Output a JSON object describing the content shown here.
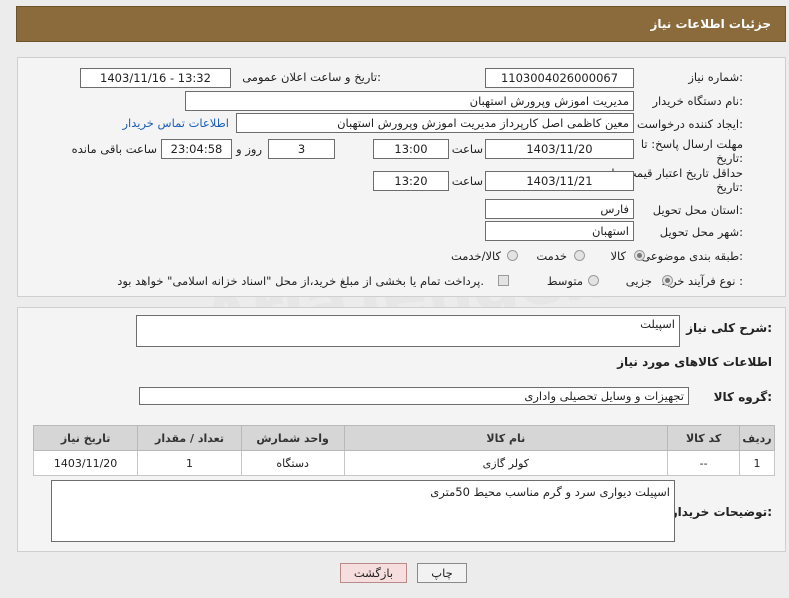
{
  "header": {
    "title": "جزئیات اطلاعات نیاز"
  },
  "form": {
    "need_number_label": "شماره نیاز:",
    "need_number": "1103004026000067",
    "announce_label": "تاریخ و ساعت اعلان عمومی:",
    "announce_value": "1403/11/16 - 13:32",
    "buyer_label": "نام دستگاه خریدار:",
    "buyer_value": "مدیریت اموزش وپرورش استهبان",
    "creator_label": "ایجاد کننده درخواست:",
    "creator_value": "معین کاظمی اصل کارپرداز مدیریت اموزش وپرورش استهبان",
    "contact_link": "اطلاعات تماس خریدار",
    "deadline_label": "مهلت ارسال پاسخ: تا تاریخ:",
    "deadline_date": "1403/11/20",
    "time_label": "ساعت",
    "deadline_time": "13:00",
    "days_value": "3",
    "days_label": "روز و",
    "remaining_time": "23:04:58",
    "remaining_label": "ساعت باقی مانده",
    "validity_label": "حداقل تاریخ اعتبار قیمت: تا تاریخ:",
    "validity_date": "1403/11/21",
    "validity_time": "13:20",
    "province_label": "استان محل تحویل:",
    "province_value": "فارس",
    "city_label": "شهر محل تحویل:",
    "city_value": "استهبان",
    "category_label": "طبقه بندی موضوعی:",
    "category_options": [
      "کالا",
      "خدمت",
      "کالا/خدمت"
    ],
    "category_selected": "کالا",
    "process_label": "نوع فرآیند خرید :",
    "process_options": [
      "جزیی",
      "متوسط"
    ],
    "process_selected": "جزیی",
    "payment_text": "پرداخت تمام یا بخشی از مبلغ خرید،از محل \"اسناد خزانه اسلامی\" خواهد بود."
  },
  "description": {
    "label": "شرح کلی نیاز:",
    "value": "اسپیلت",
    "goods_info_title": "اطلاعات کالاهای مورد نیاز",
    "group_label": "گروه کالا:",
    "group_value": "تجهیزات و وسایل تحصیلی واداری"
  },
  "table": {
    "headers": [
      "ردیف",
      "کد کالا",
      "نام کالا",
      "واحد شمارش",
      "تعداد / مقدار",
      "تاریخ نیاز"
    ],
    "rows": [
      [
        "1",
        "--",
        "کولر گازی",
        "دستگاه",
        "1",
        "1403/11/20"
      ]
    ]
  },
  "buyer_notes": {
    "label": "توضیحات خریدار:",
    "value": "اسپیلت دیواری سرد و گرم مناسب محیط 50متری"
  },
  "buttons": {
    "print": "چاپ",
    "back": "بازگشت"
  },
  "watermark": "AriaTender.neT"
}
